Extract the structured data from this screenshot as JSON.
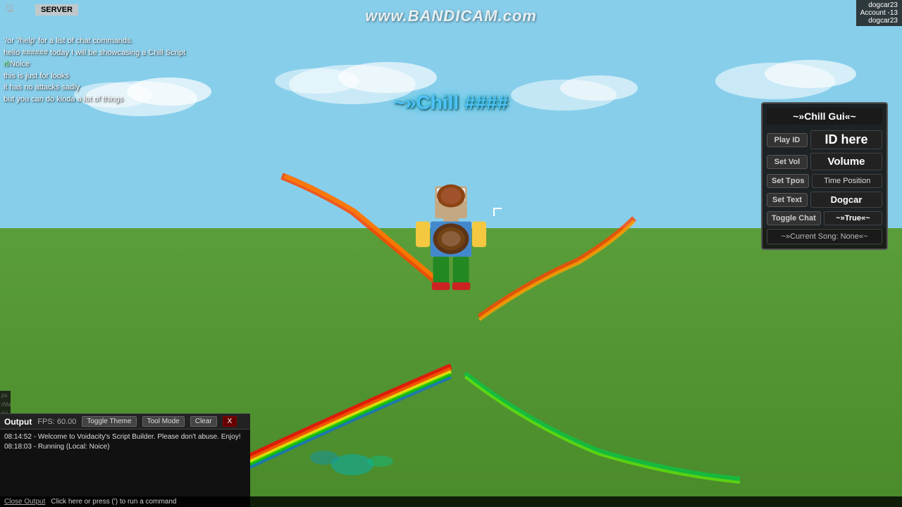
{
  "bandicam": {
    "watermark": "www.BANDICAM.com"
  },
  "top_bar": {
    "server_label": "SERVER",
    "icons": [
      "save-icon",
      "flag-icon"
    ]
  },
  "account": {
    "username": "dogcar23",
    "account_label": "Account -13",
    "display_name": "dogcar23"
  },
  "chat": {
    "lines": [
      {
        "prefix": "",
        "text": "'/or '/help' for a list of chat commands."
      },
      {
        "prefix": "",
        "text": "hello ###### today I will be showcasing a Chill Script"
      },
      {
        "prefix": "rl/",
        "text": "Noice"
      },
      {
        "prefix": "",
        "text": "this is just for looks"
      },
      {
        "prefix": "",
        "text": "it has no attacks sadly"
      },
      {
        "prefix": "",
        "text": "but you can do kinda a lot of things"
      }
    ]
  },
  "game_title": "~»Chill ####",
  "gui": {
    "title": "~»Chill Gui«~",
    "rows": [
      {
        "label": "Play ID",
        "value": "ID here",
        "value_size": "large"
      },
      {
        "label": "Set Vol",
        "value": "Volume",
        "value_size": "medium"
      },
      {
        "label": "Set Tpos",
        "value": "Time Position",
        "value_size": "small"
      },
      {
        "label": "Set Text",
        "value": "Dogcar",
        "value_size": "normal"
      }
    ],
    "toggle_chat": {
      "label": "Toggle Chat",
      "value": "~»True«~"
    },
    "current_song": "~»Current Song: None«~"
  },
  "output": {
    "label": "Output",
    "fps_label": "FPS: 60.00",
    "buttons": {
      "toggle_theme": "Toggle Theme",
      "tool_mode": "Tool Mode",
      "clear": "Clear",
      "close_x": "X"
    },
    "lines": [
      "08:14:52 - Welcome to Voidacity's Script Builder. Please don't abuse. Enjoy!",
      "08:18:03 - Running (Local: Noice)"
    ]
  },
  "close_output_bar": {
    "close_label": "Close Output",
    "run_label": "Click here or press (') to run a command"
  }
}
